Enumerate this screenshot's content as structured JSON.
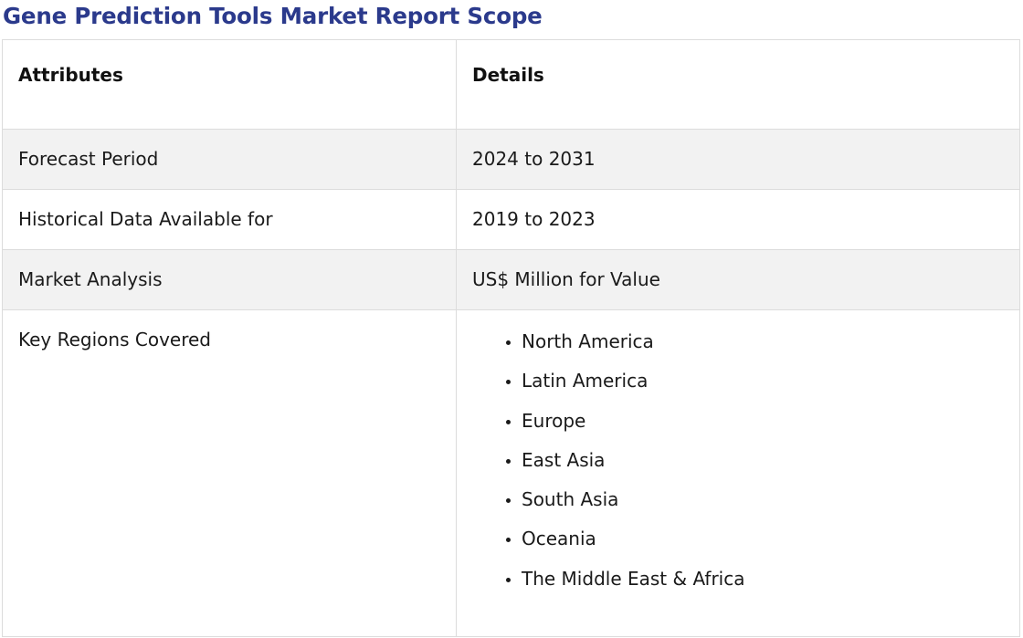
{
  "title": "Gene Prediction Tools Market Report Scope",
  "table": {
    "headers": {
      "attributes": "Attributes",
      "details": "Details"
    },
    "rows": [
      {
        "attribute": "Forecast Period",
        "detail": "2024 to 2031"
      },
      {
        "attribute": "Historical Data Available for",
        "detail": "2019 to 2023"
      },
      {
        "attribute": "Market Analysis",
        "detail": "US$ Million for Value"
      }
    ],
    "regions": {
      "attribute": "Key Regions Covered",
      "items": [
        "North America",
        "Latin America",
        "Europe",
        "East Asia",
        "South Asia",
        "Oceania",
        "The Middle East & Africa"
      ]
    }
  },
  "colors": {
    "title": "#2b3a8c",
    "shaded_row": "#f2f2f2",
    "border": "#dcdcdc"
  }
}
